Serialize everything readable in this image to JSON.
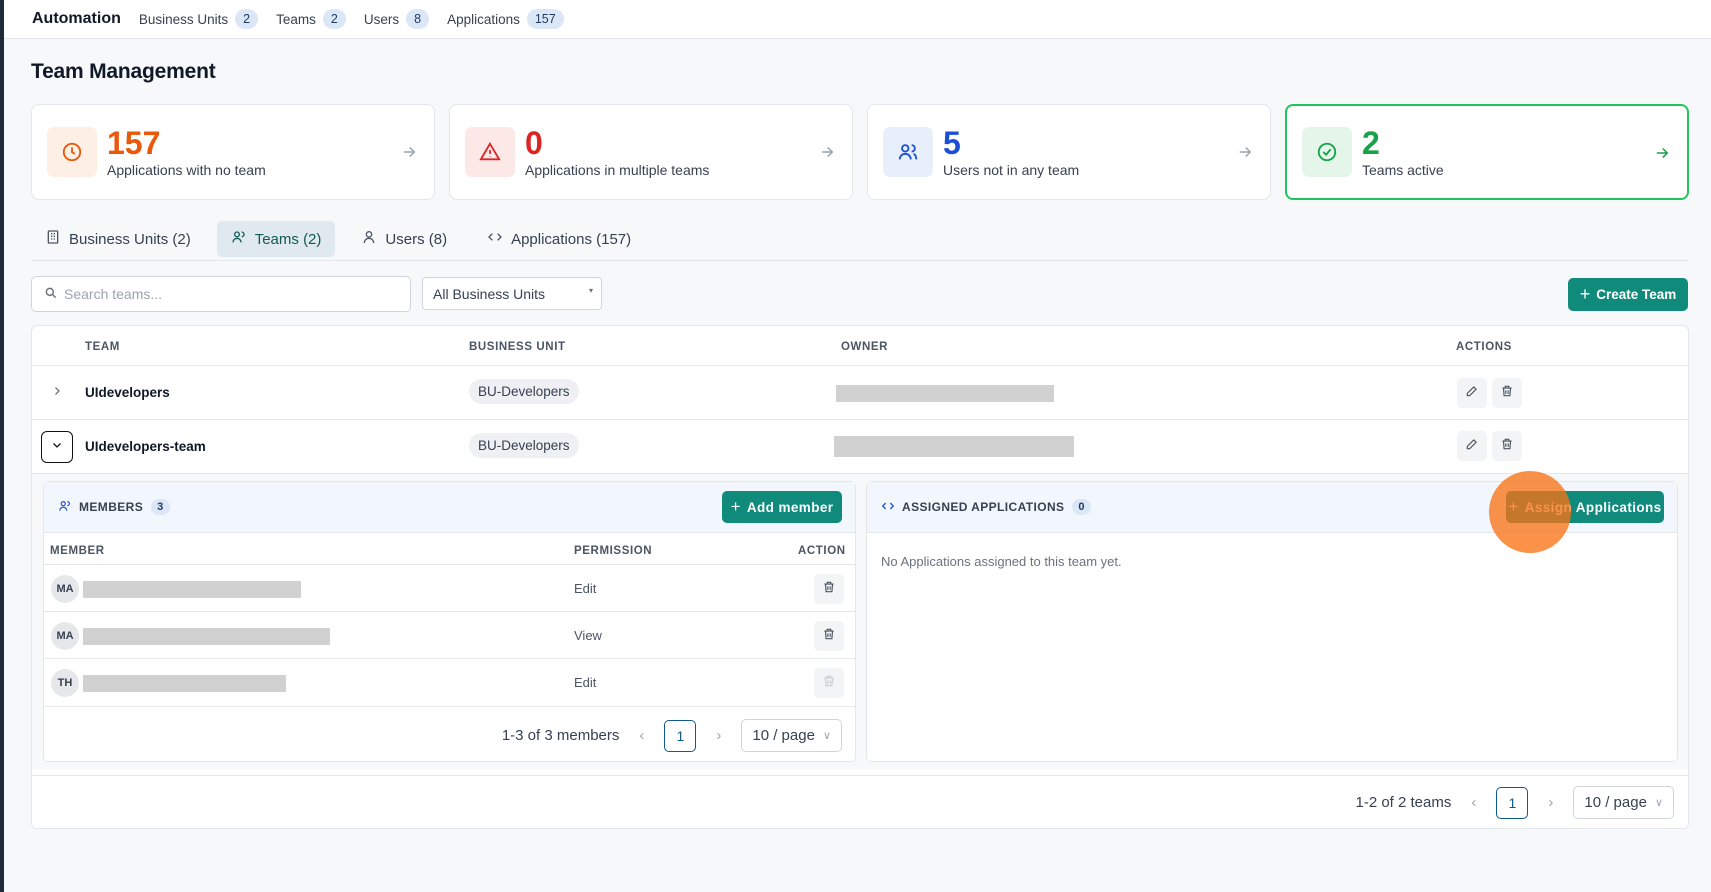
{
  "topnav": {
    "brand": "Automation",
    "items": [
      {
        "label": "Business Units",
        "count": "2"
      },
      {
        "label": "Teams",
        "count": "2"
      },
      {
        "label": "Users",
        "count": "8"
      },
      {
        "label": "Applications",
        "count": "157"
      }
    ]
  },
  "page": {
    "title": "Team Management"
  },
  "stats": [
    {
      "value": "157",
      "label": "Applications with no team",
      "color": "#ea580c",
      "icon": "clock-icon"
    },
    {
      "value": "0",
      "label": "Applications in multiple teams",
      "color": "#dc2626",
      "icon": "alert-triangle-icon"
    },
    {
      "value": "5",
      "label": "Users not in any team",
      "color": "#1d4ed8",
      "icon": "users-icon"
    },
    {
      "value": "2",
      "label": "Teams active",
      "color": "#16a34a",
      "icon": "check-circle-icon"
    }
  ],
  "tabs": [
    {
      "label": "Business Units (2)",
      "icon": "building-icon"
    },
    {
      "label": "Teams (2)",
      "icon": "users-icon",
      "selected": true
    },
    {
      "label": "Users (8)",
      "icon": "user-icon"
    },
    {
      "label": "Applications (157)",
      "icon": "code-icon"
    }
  ],
  "filters": {
    "search_placeholder": "Search teams...",
    "business_unit_selected": "All Business Units",
    "create_label": "Create Team"
  },
  "table": {
    "headers": {
      "team": "TEAM",
      "bu": "BUSINESS UNIT",
      "owner": "OWNER",
      "actions": "ACTIONS"
    },
    "rows": [
      {
        "name": "UIdevelopers",
        "bu": "BU-Developers",
        "expanded": false
      },
      {
        "name": "UIdevelopers-team",
        "bu": "BU-Developers",
        "expanded": true
      }
    ],
    "pagination": {
      "summary": "1-2 of 2 teams",
      "page": "1",
      "page_size": "10 / page"
    }
  },
  "members": {
    "title": "MEMBERS",
    "count": "3",
    "add_label": "Add member",
    "headers": {
      "member": "MEMBER",
      "permission": "PERMISSION",
      "action": "ACTION"
    },
    "rows": [
      {
        "initials": "MA",
        "permission": "Edit"
      },
      {
        "initials": "MA",
        "permission": "View"
      },
      {
        "initials": "TH",
        "permission": "Edit"
      }
    ],
    "pagination": {
      "summary": "1-3 of 3 members",
      "page": "1",
      "page_size": "10 / page"
    }
  },
  "applications": {
    "title": "ASSIGNED APPLICATIONS",
    "count": "0",
    "assign_label": "Assign Applications",
    "empty_text": "No Applications assigned to this team yet."
  }
}
